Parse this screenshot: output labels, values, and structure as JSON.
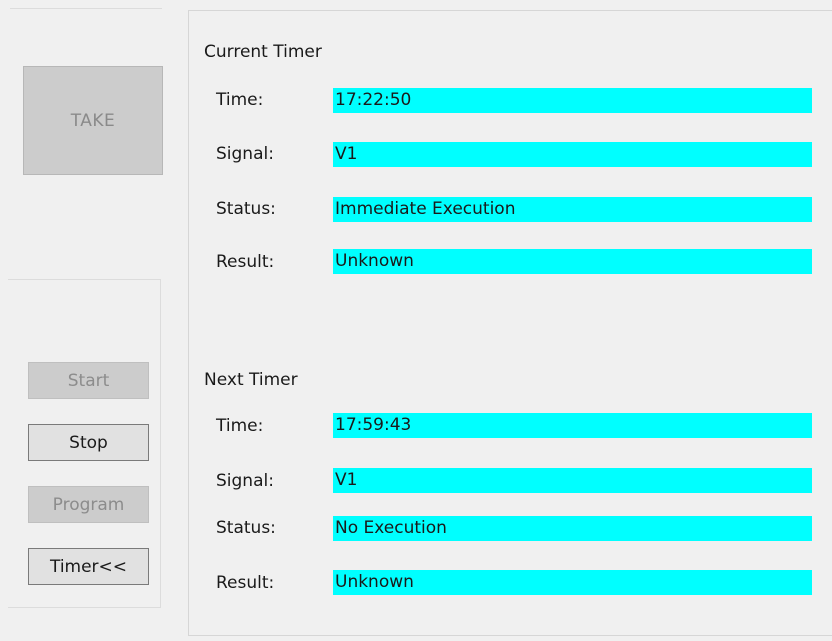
{
  "left_panel": {
    "take_label": "TAKE",
    "start_label": "Start",
    "stop_label": "Stop",
    "program_label": "Program",
    "timer_label": "Timer<<"
  },
  "current_timer": {
    "title": "Current Timer",
    "time_label": "Time:",
    "time_value": "17:22:50",
    "signal_label": "Signal:",
    "signal_value": "V1",
    "status_label": "Status:",
    "status_value": "Immediate Execution",
    "result_label": "Result:",
    "result_value": "Unknown"
  },
  "next_timer": {
    "title": "Next Timer",
    "time_label": "Time:",
    "time_value": "17:59:43",
    "signal_label": "Signal:",
    "signal_value": "V1",
    "status_label": "Status:",
    "status_value": "No Execution",
    "result_label": "Result:",
    "result_value": "Unknown"
  },
  "colors": {
    "value_background": "#00ffff",
    "disabled_button": "#cccccc",
    "window_background": "#f0f0f0"
  }
}
